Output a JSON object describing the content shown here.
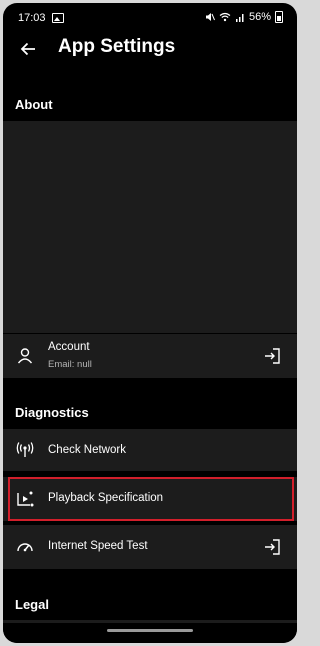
{
  "status": {
    "time": "17:03",
    "battery": "56%"
  },
  "header": {
    "title": "App Settings"
  },
  "sections": {
    "about": "About",
    "diagnostics": "Diagnostics",
    "legal": "Legal"
  },
  "account": {
    "label": "Account",
    "sub": "Email: null"
  },
  "diagnostics_items": [
    {
      "label": "Check Network",
      "icon": "antenna-icon"
    },
    {
      "label": "Playback Specification",
      "icon": "playback-spec-icon"
    },
    {
      "label": "Internet Speed Test",
      "icon": "speedometer-icon"
    }
  ],
  "colors": {
    "background": "#000000",
    "card": "#1c1c1c",
    "highlight": "#d21f2b"
  }
}
